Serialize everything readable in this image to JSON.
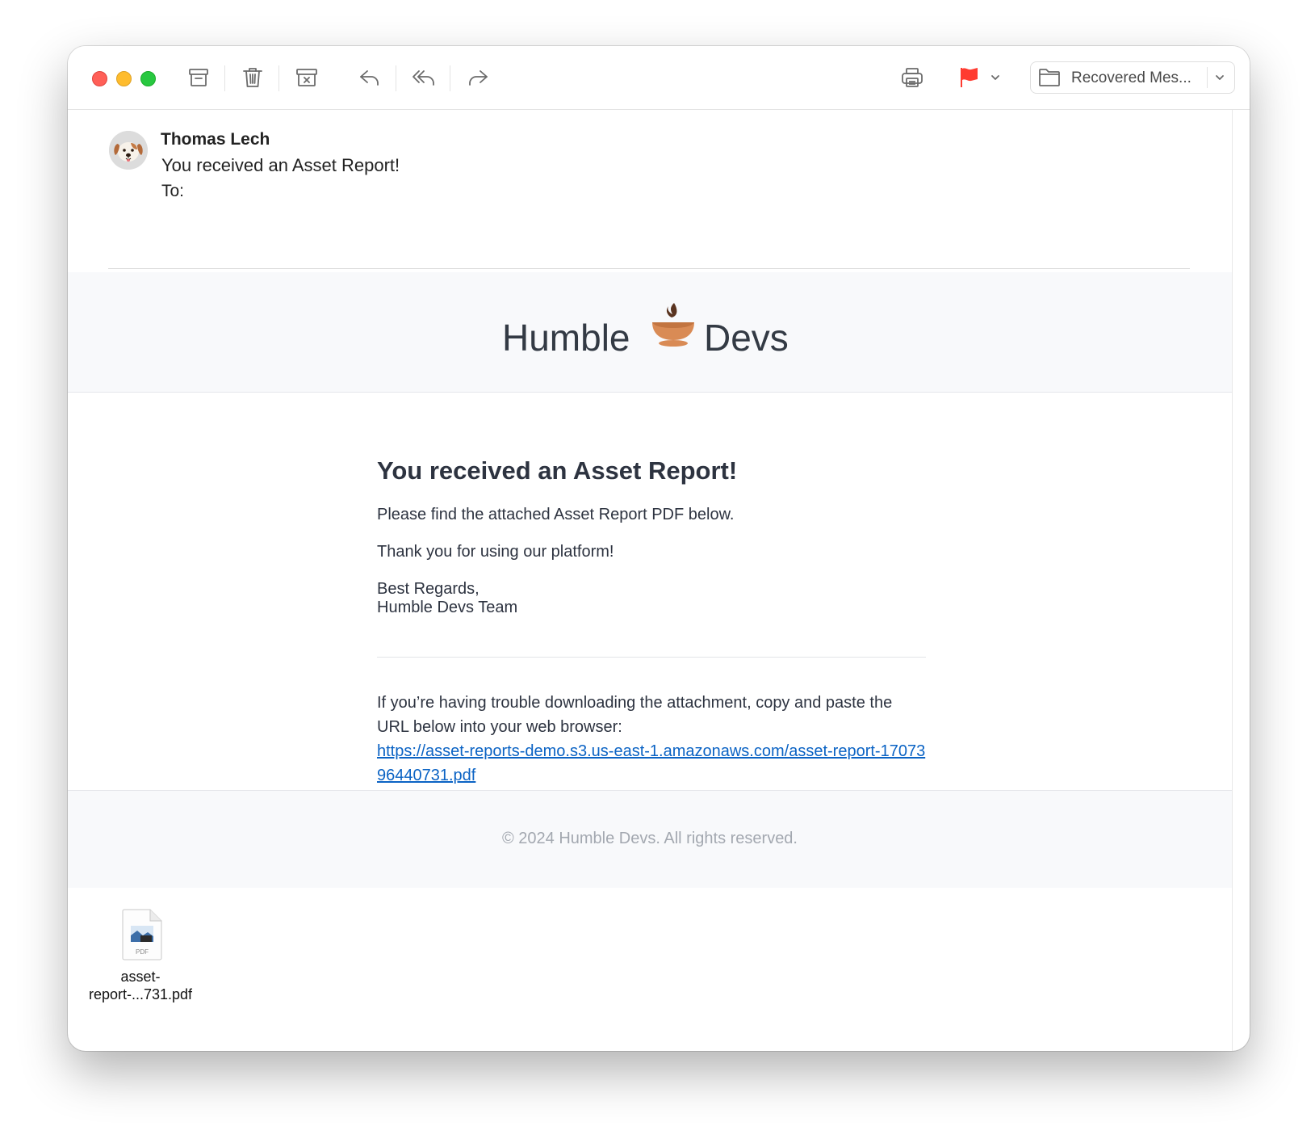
{
  "toolbar": {
    "buttons": [
      "archive-icon",
      "trash-icon",
      "junk-icon",
      "reply-icon",
      "reply-all-icon",
      "forward-icon",
      "print-icon",
      "flag-icon",
      "chevron-down-icon"
    ],
    "flag_color": "#ff3b30",
    "mailbox_label": "Recovered Mes..."
  },
  "message": {
    "sender": "Thomas Lech",
    "subject": "You received an Asset Report!",
    "to_label": "To:",
    "avatar_icon": "dog-face-icon"
  },
  "email": {
    "brand_left": "Humble",
    "brand_right": "Devs",
    "brand_icon": "coffee-cup-icon",
    "heading": "You received an Asset Report!",
    "p1": "Please find the attached Asset Report PDF below.",
    "p2": "Thank you for using our platform!",
    "signoff_1": "Best Regards,",
    "signoff_2": "Humble Devs Team",
    "trouble_text": "If you’re having trouble downloading the attachment, copy and paste the URL below into your web browser:",
    "link": "https://asset-reports-demo.s3.us-east-1.amazonaws.com/asset-report-1707396440731.pdf",
    "footer": "© 2024 Humble Devs. All rights reserved."
  },
  "attachment": {
    "name_line1": "asset-",
    "name_line2": "report-...731.pdf",
    "icon": "pdf-file-icon",
    "badge": "PDF"
  }
}
